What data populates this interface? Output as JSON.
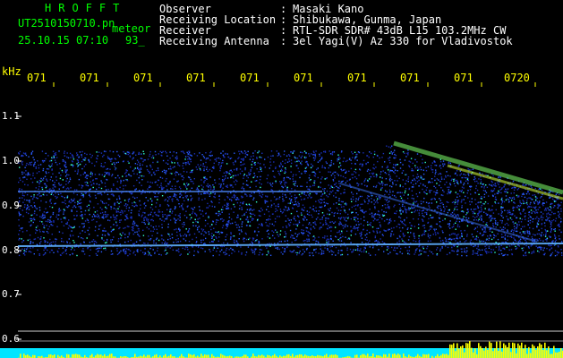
{
  "header": {
    "app_title": "HROFFT",
    "file_name": "UT2510150710.pn",
    "mode": "meteor",
    "timestamp": "25.10.15 07:10",
    "level": "93_"
  },
  "meta": {
    "rows": [
      {
        "key": "Observer",
        "value": "Masaki Kano"
      },
      {
        "key": "Receiving Location",
        "value": "Shibukawa, Gunma, Japan"
      },
      {
        "key": "Receiver",
        "value": "RTL-SDR SDR# 43dB L15 103.2MHz CW"
      },
      {
        "key": "Receiving Antenna",
        "value": "3el Yagi(V) Az 330 for Vladivostok"
      }
    ]
  },
  "axis": {
    "freq_unit": "kHz",
    "y_ticks": [
      "1.1",
      "1.0",
      "0.9",
      "0.8",
      "0.7",
      "0.6"
    ],
    "time_ticks": [
      "071",
      "071",
      "071",
      "071",
      "071",
      "071",
      "071",
      "071",
      "071",
      "0720"
    ]
  },
  "colors": {
    "background": "#000000",
    "header_green": "#00ff00",
    "tick_yellow": "#ffff00",
    "signal_blue": "#1f3cff",
    "bottom_cyan": "#00e5ff"
  }
}
